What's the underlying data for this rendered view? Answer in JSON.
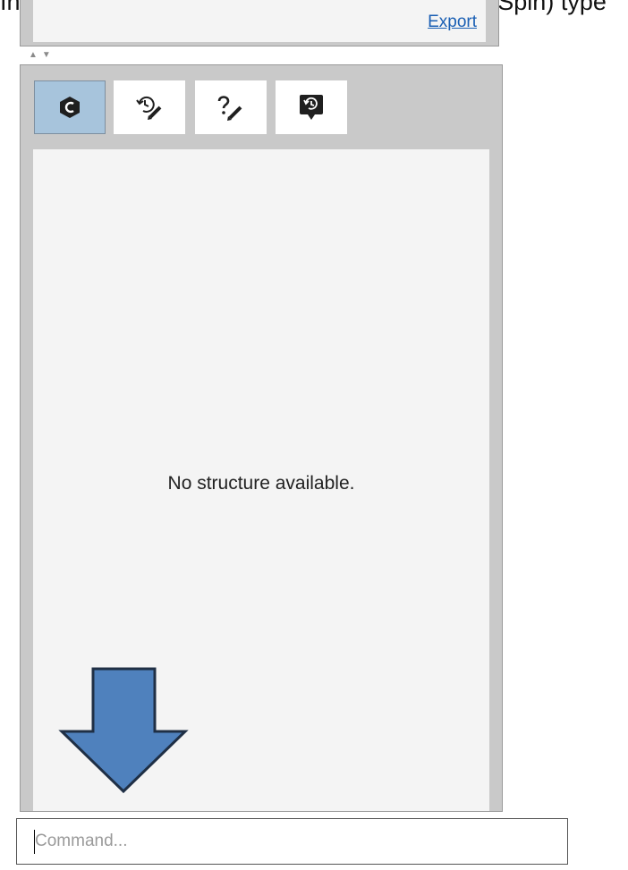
{
  "caption": "In the Command line (bottom left corner of TopSpin) type",
  "top_panel": {
    "export_label": "Export"
  },
  "splitter": {
    "up": "▲",
    "down": "▼"
  },
  "toolbar": {
    "buttons": [
      {
        "icon": "structure-icon",
        "active": true
      },
      {
        "icon": "history-edit-icon",
        "active": false
      },
      {
        "icon": "help-edit-icon",
        "active": false
      },
      {
        "icon": "history-comment-icon",
        "active": false
      }
    ]
  },
  "content": {
    "empty_message": "No structure available."
  },
  "command": {
    "placeholder": "Command...",
    "value": ""
  },
  "colors": {
    "arrow_fill": "#4f81bd",
    "arrow_stroke": "#1f2f45",
    "active_tab": "#a7c4dc",
    "link": "#1a5fb4"
  }
}
